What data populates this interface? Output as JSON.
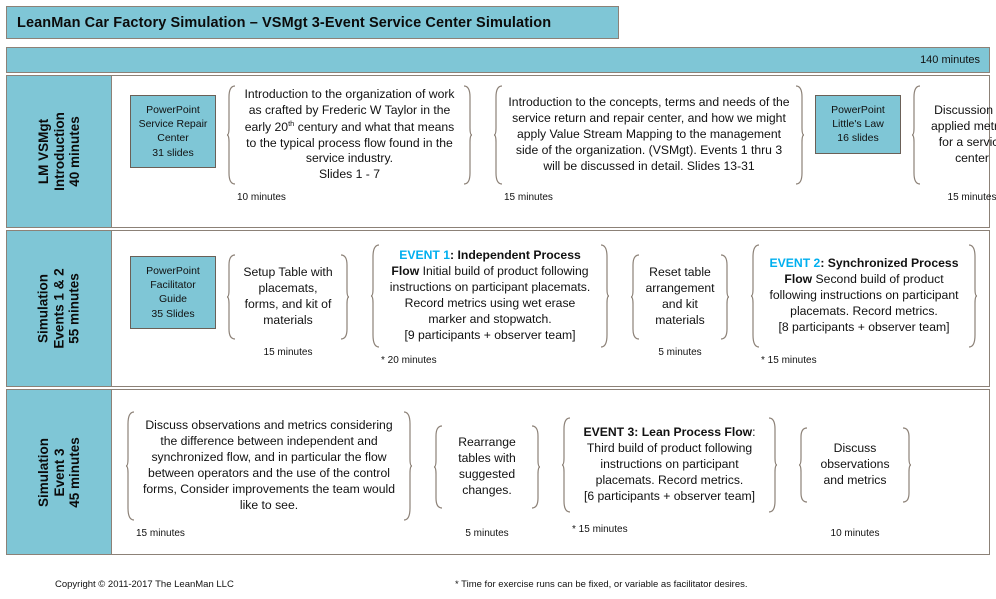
{
  "title": "LeanMan Car Factory Simulation – VSMgt 3-Event Service Center Simulation",
  "total_time": "140 minutes",
  "accent_color": "#7FC6D6",
  "event_highlight_color": "#00AFEF",
  "border_color": "#8c8177",
  "rows": [
    {
      "label_lines": [
        "LM VSMgt",
        "Introduction",
        "40 minutes"
      ],
      "ppt": {
        "lines": [
          "PowerPoint",
          "Service Repair",
          "Center",
          "31 slides"
        ],
        "title": "PowerPoint Service Repair Center 31 slides"
      },
      "blocks": [
        {
          "text": "Introduction to the organization of work as crafted by Frederic W Taylor in the early 20th century and what that means to the typical process flow found in the service industry. Slides 1 - 7",
          "duration": "10 minutes"
        },
        {
          "text": "Introduction to the concepts, terms and needs of the service return and repair center, and how we might apply Value Stream Mapping to the management side of the organization. (VSMgt). Events 1 thru 3 will be discussed in detail. Slides 13-31",
          "duration": "15 minutes"
        },
        {
          "text": "Discussion on applied metrics for a service center",
          "duration": "15 minutes"
        }
      ],
      "ppt2": {
        "lines": [
          "PowerPoint",
          "Little's Law",
          "16 slides"
        ],
        "title": "PowerPoint Little's Law 16 slides"
      }
    },
    {
      "label_lines": [
        "Simulation",
        "Events 1 & 2",
        "55 minutes"
      ],
      "ppt": {
        "lines": [
          "PowerPoint",
          "Facilitator",
          "Guide",
          "35 Slides"
        ],
        "title": "PowerPoint Facilitator Guide 35 Slides"
      },
      "blocks": [
        {
          "text": "Setup Table with placemats, forms, and kit of materials",
          "duration": "15 minutes"
        },
        {
          "event_label": "EVENT 1",
          "event_title": ": Independent Process Flow",
          "text": ": Initial build of product following instructions on participant placemats.  Record metrics using wet erase marker and stopwatch. [9 participants + observer team]",
          "duration": "* 20 minutes"
        },
        {
          "text": "Reset table arrangement and kit materials",
          "duration": "5 minutes"
        },
        {
          "event_label": "EVENT 2",
          "event_title": ": Synchronized Process Flow",
          "text": ": Second build of product following instructions on participant placemats. Record metrics. [8 participants + observer team]",
          "duration": "* 15 minutes"
        }
      ]
    },
    {
      "label_lines": [
        "Simulation",
        "Event 3",
        "45 minutes"
      ],
      "blocks": [
        {
          "text": "Discuss observations and metrics considering the difference between independent and synchronized flow, and in particular the flow between operators and the use of the control forms,  Consider improvements the team would like to see.",
          "duration": "15 minutes"
        },
        {
          "text": "Rearrange tables with suggested changes.",
          "duration": "5 minutes"
        },
        {
          "event_label": "EVENT 3",
          "event_title": ": Lean Process Flow",
          "text": ": Third build of product following instructions on participant placemats. Record metrics. [6 participants + observer team]",
          "duration": "* 15 minutes"
        },
        {
          "text": "Discuss observations and metrics",
          "duration": "10 minutes"
        }
      ]
    }
  ],
  "footer": {
    "copyright": "Copyright © 2011-2017 The LeanMan LLC",
    "note": "* Time for exercise runs can be fixed, or variable as facilitator desires."
  }
}
